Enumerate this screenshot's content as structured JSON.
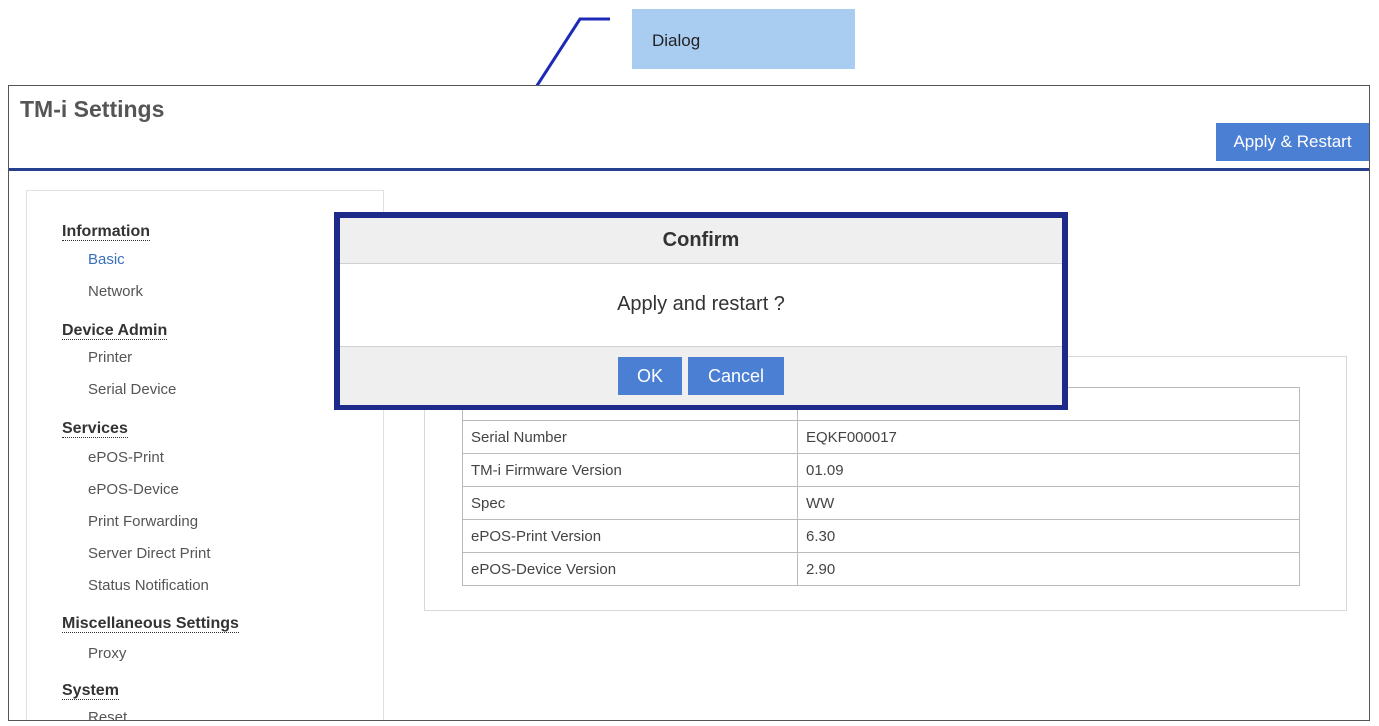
{
  "callout": {
    "label": "Dialog"
  },
  "app": {
    "title": "TM-i Settings",
    "apply_button": "Apply & Restart"
  },
  "sidebar": {
    "sections": [
      {
        "heading": "Information",
        "items": [
          "Basic",
          "Network"
        ]
      },
      {
        "heading": "Device Admin",
        "items": [
          "Printer",
          "Serial Device"
        ]
      },
      {
        "heading": "Services",
        "items": [
          "ePOS-Print",
          "ePOS-Device",
          "Print Forwarding",
          "Server Direct Print",
          "Status Notification"
        ]
      },
      {
        "heading": "Miscellaneous Settings",
        "items": [
          "Proxy"
        ]
      },
      {
        "heading": "System",
        "items": [
          "Reset"
        ]
      }
    ],
    "active_item": "Basic"
  },
  "info_table": {
    "rows": [
      {
        "key": "",
        "value": ""
      },
      {
        "key": "Serial Number",
        "value": "EQKF000017"
      },
      {
        "key": "TM-i Firmware Version",
        "value": "01.09"
      },
      {
        "key": "Spec",
        "value": "WW"
      },
      {
        "key": "ePOS-Print Version",
        "value": "6.30"
      },
      {
        "key": "ePOS-Device Version",
        "value": "2.90"
      }
    ]
  },
  "dialog": {
    "title": "Confirm",
    "message": "Apply and restart ?",
    "ok_label": "OK",
    "cancel_label": "Cancel"
  },
  "colors": {
    "accent": "#4a7fd4",
    "header_rule": "#24408f",
    "dialog_border": "#1d2a8a",
    "callout": "#a9cdf1"
  }
}
